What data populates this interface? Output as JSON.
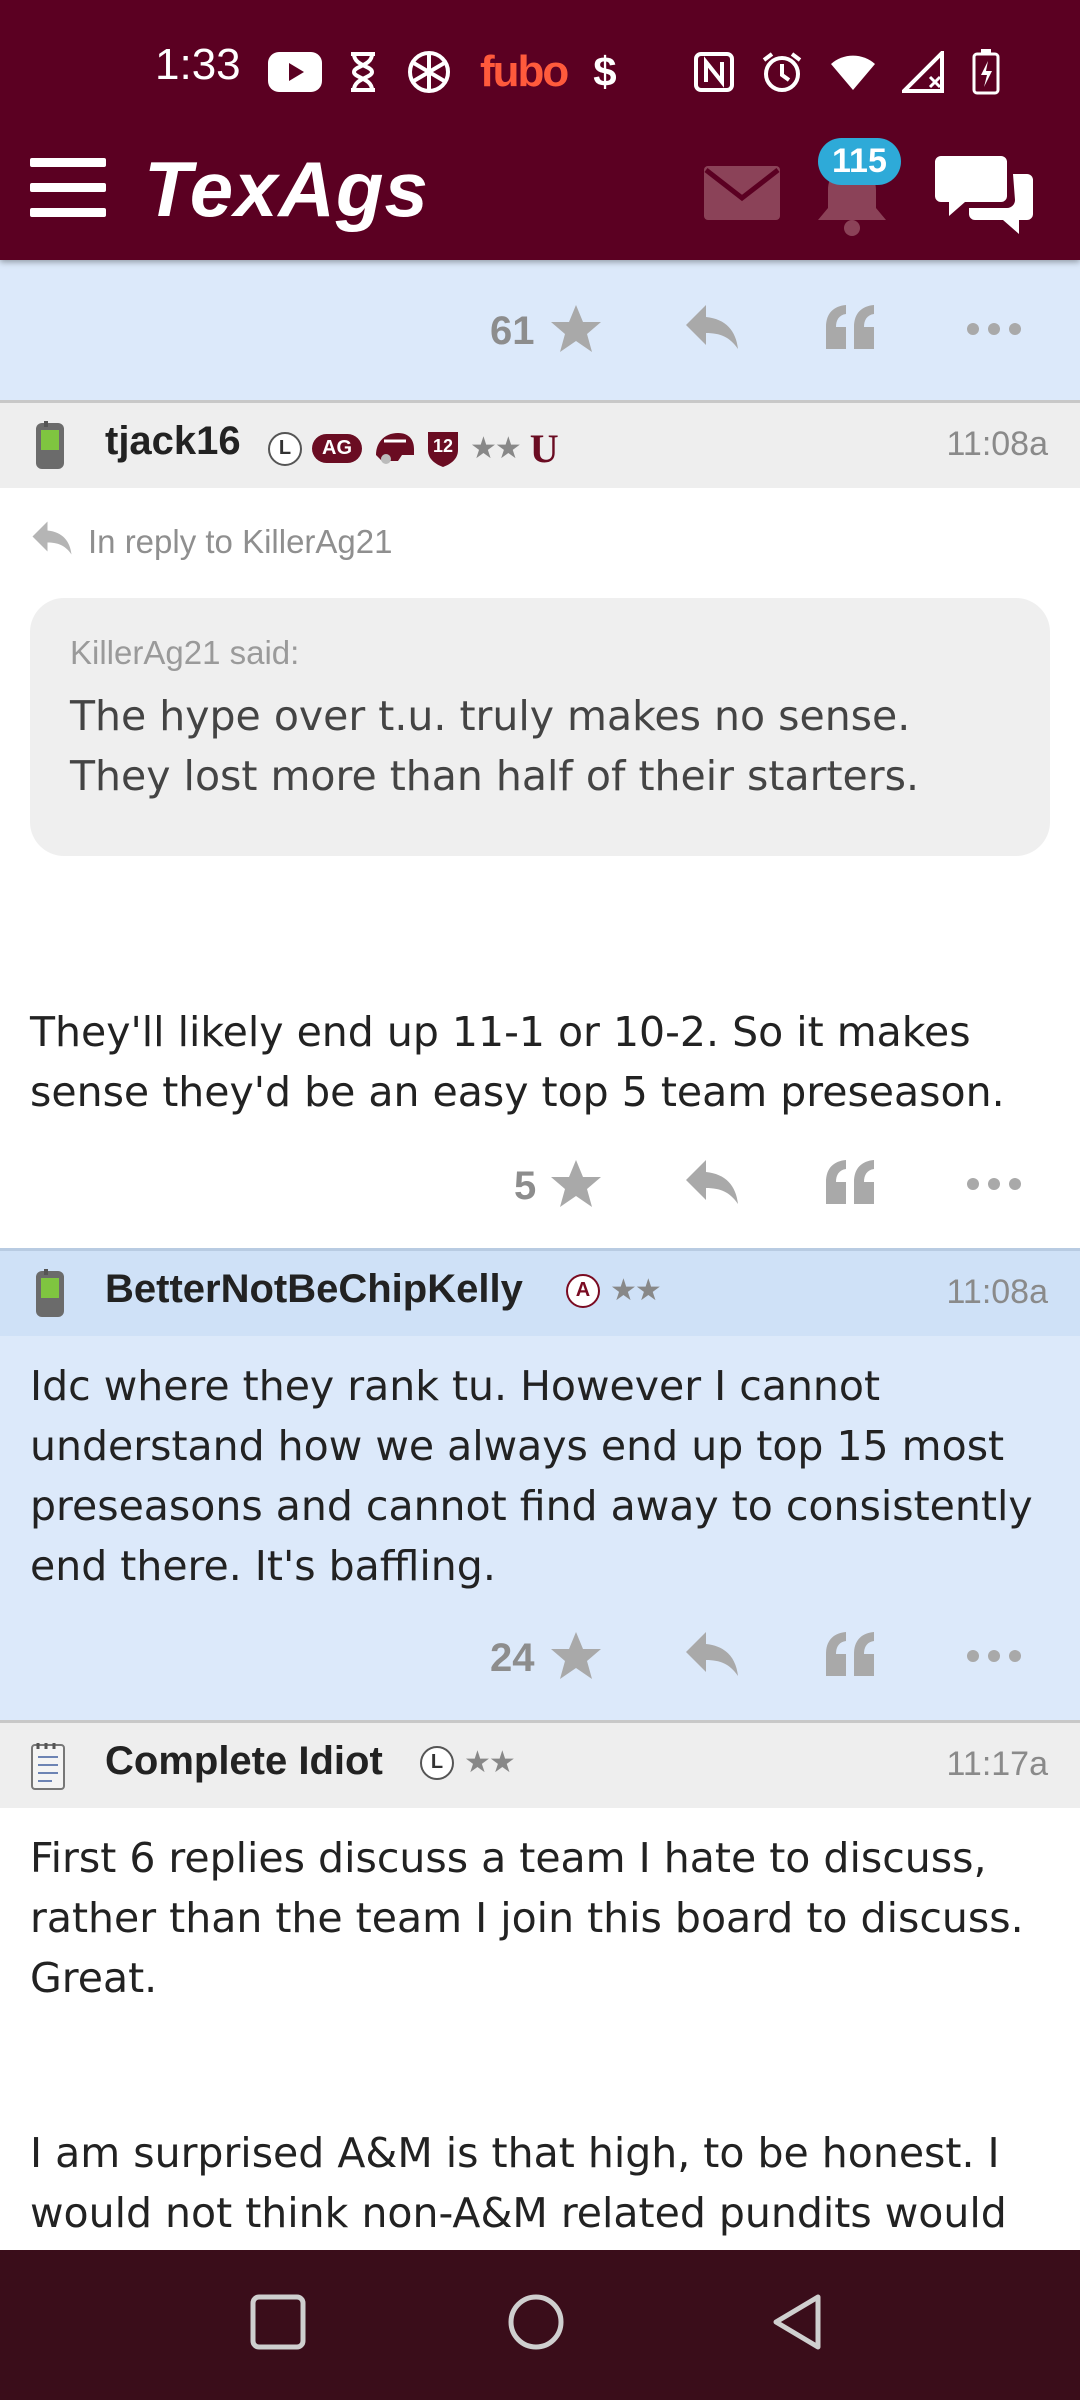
{
  "status_bar": {
    "time": "1:33",
    "icons": [
      "youtube-icon",
      "hourglass-icon",
      "openai-icon",
      "fubo-icon",
      "dollar-icon",
      "nfc-icon",
      "alarm-icon",
      "wifi-icon",
      "signal-icon",
      "battery-icon"
    ],
    "fubo_label": "fubo",
    "dollar_label": "$"
  },
  "header": {
    "logo": "TexAgs",
    "notification_count": "115",
    "colors": {
      "bar": "#5b0022",
      "badge": "#2eaad8"
    }
  },
  "posts": [
    {
      "highlighted": true,
      "star_count": "61"
    },
    {
      "username": "tjack16",
      "time": "11:08a",
      "badge_l": "L",
      "badge_ag": "AG",
      "badge_12": "12",
      "stars": "★★",
      "badge_u": "U",
      "reply_to": "In reply to KillerAg21",
      "quote_author": "KillerAg21 said:",
      "quote_text": "The hype over t.u. truly makes no sense. They lost more than half of their starters.",
      "body": "They'll likely end up 11-1 or 10-2. So it makes sense they'd be an easy top 5 team preseason.",
      "star_count": "5"
    },
    {
      "username": "BetterNotBeChipKelly",
      "time": "11:08a",
      "badge_a": "A",
      "stars": "★★",
      "body": "Idc where they rank tu. However I cannot understand how we always end up top 15 most preseasons and cannot find away to consistently end there. It's baffling.",
      "star_count": "24",
      "highlighted": true
    },
    {
      "username": "Complete Idiot",
      "time": "11:17a",
      "badge_l": "L",
      "stars": "★★",
      "body_p1": "First 6 replies discuss a team I hate to discuss, rather than the team I join this board to discuss. Great.",
      "body_p2": "I am surprised A&M is that high, to be honest. I would not think non-A&M related pundits would"
    }
  ],
  "nav": {
    "buttons": [
      "recents-button",
      "home-button",
      "back-button"
    ]
  }
}
